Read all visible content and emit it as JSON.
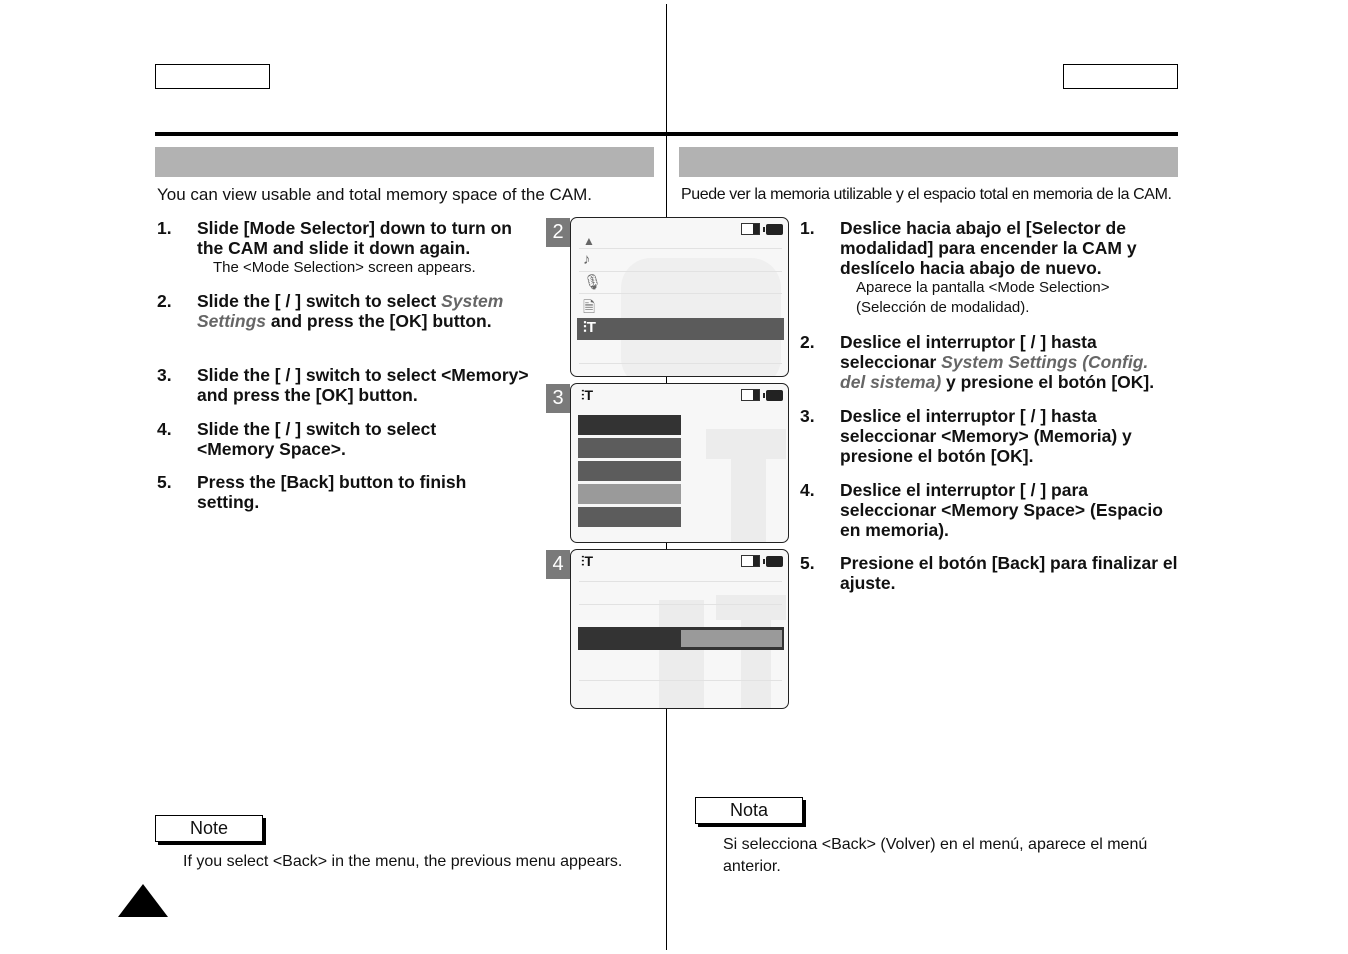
{
  "left": {
    "intro": "You can view usable and total memory space of the CAM.",
    "steps": [
      {
        "num": "1.",
        "text": "Slide [Mode Selector] down to turn on the CAM and slide it down again.",
        "sub": "The <Mode Selection> screen appears."
      },
      {
        "num": "2.",
        "text_pre": "Slide the [    /    ] switch to select ",
        "em": "System Settings",
        "text_post": " and press the [OK] button."
      },
      {
        "num": "3.",
        "text": "Slide the [    /    ] switch to select <Memory> and press the [OK] button."
      },
      {
        "num": "4.",
        "text": "Slide the [    /    ] switch to select <Memory Space>."
      },
      {
        "num": "5.",
        "text": "Press the [Back] button to finish setting."
      }
    ],
    "note_label": "Note",
    "note_text": "If you select <Back> in the menu, the previous menu appears."
  },
  "right": {
    "intro": "Puede ver la memoria utilizable y el espacio total en memoria de la CAM.",
    "steps": [
      {
        "num": "1.",
        "text": "Deslice hacia abajo el [Selector de modalidad] para encender la CAM y deslícelo hacia abajo de nuevo.",
        "sub": "Aparece la pantalla <Mode Selection> (Selección de modalidad)."
      },
      {
        "num": "2.",
        "text_pre": "Deslice el interruptor [    /    ] hasta seleccionar ",
        "em": "System Settings (Config. del sistema)",
        "text_post": " y presione el botón [OK]."
      },
      {
        "num": "3.",
        "text": "Deslice el interruptor [    /    ] hasta seleccionar <Memory> (Memoria) y presione el botón [OK]."
      },
      {
        "num": "4.",
        "text": "Deslice el interruptor [    /    ] para seleccionar <Memory Space> (Espacio en memoria)."
      },
      {
        "num": "5.",
        "text": "Presione el botón [Back] para finalizar el ajuste."
      }
    ],
    "note_label": "Nota",
    "note_text": "Si selecciona <Back> (Volver) en el menú, aparece el menú anterior."
  },
  "screens": [
    {
      "badge": "2",
      "icons": [
        "up-arrow",
        "music-note",
        "microphone",
        "document",
        "settings"
      ],
      "selected": "settings"
    },
    {
      "badge": "3",
      "menu_bars": [
        "dark",
        "mid",
        "mid",
        "light",
        "mid"
      ]
    },
    {
      "badge": "4",
      "memory_used_fraction": 0.5
    }
  ]
}
